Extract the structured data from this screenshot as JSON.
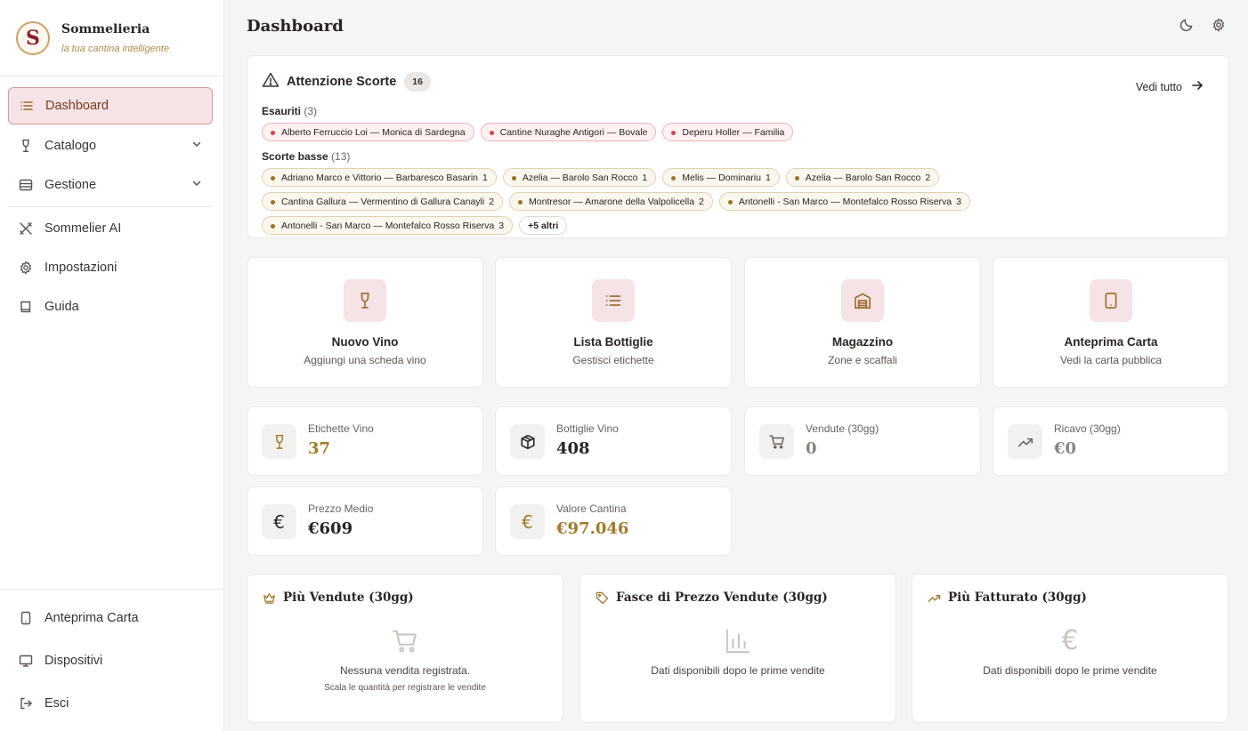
{
  "brand": {
    "name": "Sommelieria",
    "tagline": "la tua cantina intelligente",
    "logo_letter": "S"
  },
  "sidebar": {
    "items": [
      {
        "label": "Dashboard",
        "icon": "list-icon",
        "active": true
      },
      {
        "label": "Catalogo",
        "icon": "wine-glass-icon",
        "expandable": true
      },
      {
        "label": "Gestione",
        "icon": "storage-icon",
        "expandable": true
      },
      {
        "label": "Sommelier AI",
        "icon": "utensils-icon"
      },
      {
        "label": "Impostazioni",
        "icon": "gear-icon"
      },
      {
        "label": "Guida",
        "icon": "book-icon"
      }
    ],
    "footer": [
      {
        "label": "Anteprima Carta",
        "icon": "tablet-icon"
      },
      {
        "label": "Dispositivi",
        "icon": "monitor-icon"
      },
      {
        "label": "Esci",
        "icon": "logout-icon"
      }
    ]
  },
  "header": {
    "title": "Dashboard",
    "icons": [
      "moon-icon",
      "gear-icon"
    ]
  },
  "alert": {
    "title": "Attenzione Scorte",
    "count": "16",
    "see_all": "Vedi tutto",
    "out_label": "Esauriti",
    "out_count": "(3)",
    "out_items": [
      "Alberto Ferruccio Loi — Monica di Sardegna",
      "Cantine Nuraghe Antigori — Bovale",
      "Deperu Holler — Familia"
    ],
    "low_label": "Scorte basse",
    "low_count": "(13)",
    "low_items": [
      {
        "name": "Adriano Marco e Vittorio — Barbaresco Basarin",
        "qty": "1"
      },
      {
        "name": "Azelia — Barolo San Rocco",
        "qty": "1"
      },
      {
        "name": "Melis — Dominariu",
        "qty": "1"
      },
      {
        "name": "Azelia — Barolo San Rocco",
        "qty": "2"
      },
      {
        "name": "Cantina Gallura — Vermentino di Gallura Canayli",
        "qty": "2"
      },
      {
        "name": "Montresor — Amarone della Valpolicella",
        "qty": "2"
      },
      {
        "name": "Antonelli - San Marco — Montefalco Rosso Riserva",
        "qty": "3"
      },
      {
        "name": "Antonelli - San Marco — Montefalco Rosso Riserva",
        "qty": "3"
      }
    ],
    "more": "+5 altri"
  },
  "quick_actions": [
    {
      "title": "Nuovo Vino",
      "sub": "Aggiungi una scheda vino",
      "icon": "wine-glass-icon"
    },
    {
      "title": "Lista Bottiglie",
      "sub": "Gestisci etichette",
      "icon": "list-icon"
    },
    {
      "title": "Magazzino",
      "sub": "Zone e scaffali",
      "icon": "warehouse-icon"
    },
    {
      "title": "Anteprima Carta",
      "sub": "Vedi la carta pubblica",
      "icon": "tablet-icon"
    }
  ],
  "stats": [
    {
      "label": "Etichette Vino",
      "value": "37",
      "icon": "wine-glass-icon"
    },
    {
      "label": "Bottiglie Vino",
      "value": "408",
      "icon": "box-icon"
    },
    {
      "label": "Vendute (30gg)",
      "value": "0",
      "icon": "cart-icon"
    },
    {
      "label": "Ricavo (30gg)",
      "value": "€0",
      "icon": "trend-up-icon"
    },
    {
      "label": "Prezzo Medio",
      "value": "€609",
      "icon": "euro-icon"
    },
    {
      "label": "Valore Cantina",
      "value": "€97.046",
      "icon": "euro-icon"
    }
  ],
  "bottom": [
    {
      "title": "Più Vendute (30gg)",
      "icon": "crown-icon",
      "message": "Nessuna vendita registrata.",
      "sub": "Scala le quantità per registrare le vendite"
    },
    {
      "title": "Fasce di Prezzo Vendute (30gg)",
      "icon": "tag-icon",
      "message": "Dati disponibili dopo le prime vendite"
    },
    {
      "title": "Più Fatturato (30gg)",
      "icon": "trend-up-icon",
      "message": "Dati disponibili dopo le prime vendite"
    }
  ],
  "colors": {
    "accent": "#a07a2a",
    "active_bg": "#f5e3e5",
    "out_dot": "#d9434f",
    "low_dot": "#9a7424"
  }
}
